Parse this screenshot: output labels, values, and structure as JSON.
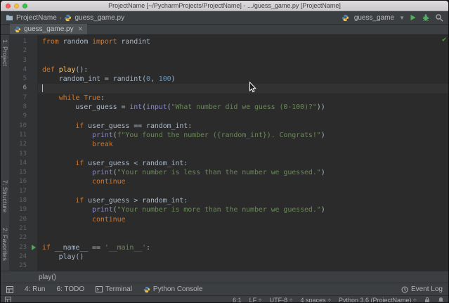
{
  "window": {
    "title": "ProjectName [~/PycharmProjects/ProjectName] - .../guess_game.py [ProjectName]"
  },
  "toolbar": {
    "project": "ProjectName",
    "file": "guess_game.py",
    "run_config": "guess_game"
  },
  "editor_tab": {
    "label": "guess_game.py",
    "close": "✕"
  },
  "tool_stripes": {
    "left": [
      "1: Project",
      "7: Structure",
      "2: Favorites"
    ]
  },
  "editor": {
    "line_count": 25,
    "current_line": 6,
    "run_marker_line": 23,
    "inspection_status": "✔",
    "lines": [
      [
        [
          "kw",
          "from"
        ],
        [
          "pl",
          " random "
        ],
        [
          "kw",
          "import"
        ],
        [
          "pl",
          " randint"
        ]
      ],
      [],
      [],
      [
        [
          "kw",
          "def"
        ],
        [
          "pl",
          " "
        ],
        [
          "fn",
          "play"
        ],
        [
          "pl",
          "():"
        ]
      ],
      [
        [
          "pl",
          "    random_int = randint("
        ],
        [
          "nm",
          "0"
        ],
        [
          "pl",
          ", "
        ],
        [
          "nm",
          "100"
        ],
        [
          "pl",
          ")"
        ]
      ],
      [],
      [
        [
          "pl",
          "    "
        ],
        [
          "kw",
          "while"
        ],
        [
          "pl",
          " "
        ],
        [
          "kw",
          "True"
        ],
        [
          "pl",
          ":"
        ]
      ],
      [
        [
          "pl",
          "        user_guess = "
        ],
        [
          "bi",
          "int"
        ],
        [
          "pl",
          "("
        ],
        [
          "bi",
          "input"
        ],
        [
          "pl",
          "("
        ],
        [
          "st",
          "\"What number did we guess (0-100)?\""
        ],
        [
          "pl",
          "))"
        ]
      ],
      [],
      [
        [
          "pl",
          "        "
        ],
        [
          "kw",
          "if"
        ],
        [
          "pl",
          " user_guess == random_int:"
        ]
      ],
      [
        [
          "pl",
          "            "
        ],
        [
          "bi",
          "print"
        ],
        [
          "pl",
          "("
        ],
        [
          "st",
          "f\"You found the number ({random_int}). Congrats!\""
        ],
        [
          "pl",
          ")"
        ]
      ],
      [
        [
          "pl",
          "            "
        ],
        [
          "kw",
          "break"
        ]
      ],
      [],
      [
        [
          "pl",
          "        "
        ],
        [
          "kw",
          "if"
        ],
        [
          "pl",
          " user_guess < random_int:"
        ]
      ],
      [
        [
          "pl",
          "            "
        ],
        [
          "bi",
          "print"
        ],
        [
          "pl",
          "("
        ],
        [
          "st",
          "\"Your number is less than the number we guessed.\""
        ],
        [
          "pl",
          ")"
        ]
      ],
      [
        [
          "pl",
          "            "
        ],
        [
          "kw",
          "continue"
        ]
      ],
      [],
      [
        [
          "pl",
          "        "
        ],
        [
          "kw",
          "if"
        ],
        [
          "pl",
          " user_guess > random_int:"
        ]
      ],
      [
        [
          "pl",
          "            "
        ],
        [
          "bi",
          "print"
        ],
        [
          "pl",
          "("
        ],
        [
          "st",
          "\"Your number is more than the number we guessed.\""
        ],
        [
          "pl",
          ")"
        ]
      ],
      [
        [
          "pl",
          "            "
        ],
        [
          "kw",
          "continue"
        ]
      ],
      [],
      [],
      [
        [
          "kw",
          "if"
        ],
        [
          "pl",
          " __name__ == "
        ],
        [
          "st",
          "'__main__'"
        ],
        [
          "pl",
          ":"
        ]
      ],
      [
        [
          "pl",
          "    play()"
        ]
      ],
      []
    ]
  },
  "breadcrumbs": {
    "label": "play()"
  },
  "bottom_bar": {
    "items": [
      "4: Run",
      "6: TODO",
      "Terminal",
      "Python Console"
    ],
    "right": "Event Log"
  },
  "status_bar": {
    "items": [
      "6:1",
      "LF ÷",
      "UTF-8 ÷",
      "4 spaces ÷",
      "Python 3.6 (ProjectName) ÷"
    ]
  },
  "colors": {
    "keyword": "#CC7832",
    "string": "#6A8759",
    "number": "#6897BB",
    "builtin": "#8888C6",
    "function": "#FFC66D",
    "text": "#A9B7C6",
    "editor_bg": "#2B2B2B",
    "gutter_bg": "#313335",
    "bar_bg": "#3C3F41",
    "run_green": "#50A754",
    "current_line": "#323232"
  }
}
